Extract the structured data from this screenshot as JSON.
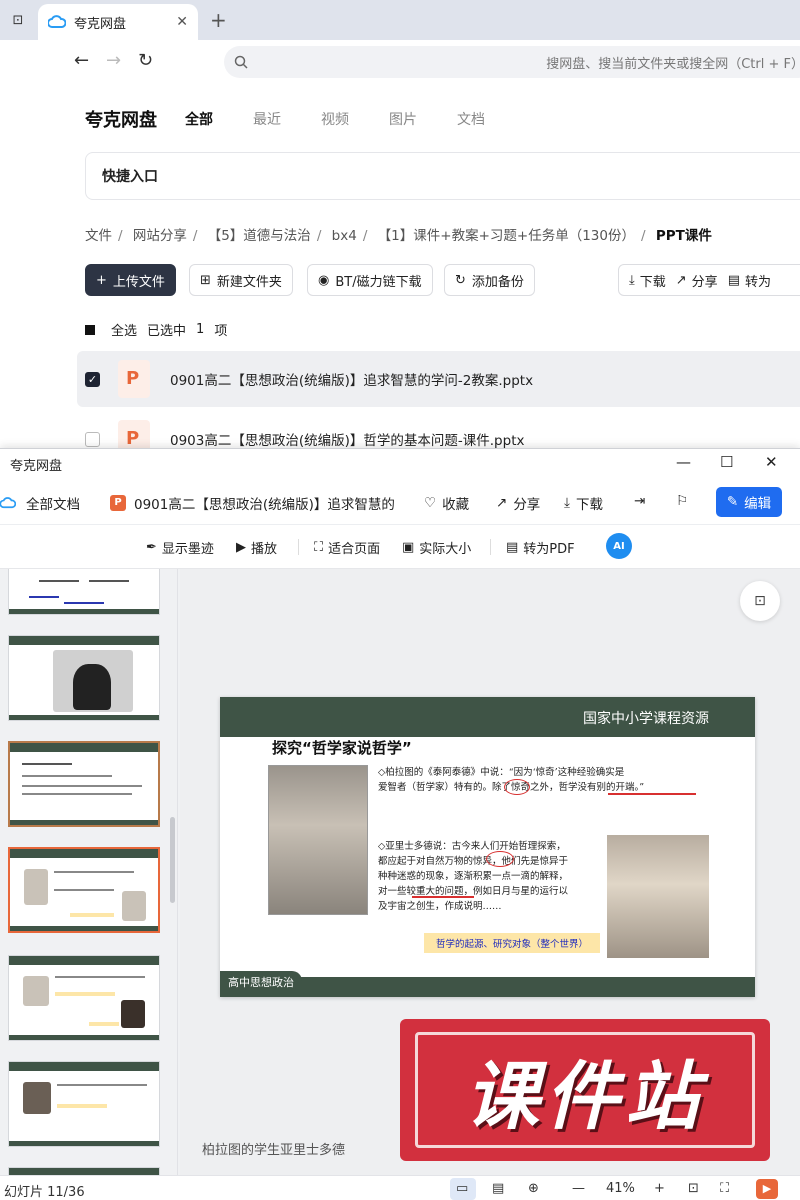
{
  "browser": {
    "tab_title": "夸克网盘",
    "search_placeholder": "搜网盘、搜当前文件夹或搜全网（Ctrl + F）"
  },
  "drive": {
    "brand": "夸克网盘",
    "nav_tabs": [
      "全部",
      "最近",
      "视频",
      "图片",
      "文档"
    ],
    "quick_entry": "快捷入口",
    "breadcrumb": [
      "文件",
      "网站分享",
      "【5】道德与法治",
      "bx4",
      "【1】课件+教案+习题+任务单（130份）",
      "PPT课件"
    ],
    "actions": {
      "upload": "上传文件",
      "new_folder": "新建文件夹",
      "bt": "BT/磁力链下载",
      "backup": "添加备份",
      "download": "下载",
      "share": "分享",
      "convert": "转为"
    },
    "selection": {
      "select_all": "全选",
      "selected": "已选中",
      "count": "1",
      "unit": "项"
    },
    "files": [
      {
        "name": "0901高二【思想政治(统编版)】追求智慧的学问-2教案.pptx",
        "checked": true
      },
      {
        "name": "0903高二【思想政治(统编版)】哲学的基本问题-课件.pptx",
        "checked": false
      }
    ]
  },
  "viewer": {
    "window_title": "夸克网盘",
    "all_docs": "全部文档",
    "doc_title": "0901高二【思想政治(统编版)】追求智慧的",
    "collect": "收藏",
    "share": "分享",
    "download": "下载",
    "edit": "编辑",
    "tools": {
      "ink": "显示墨迹",
      "play": "播放",
      "fit": "适合页面",
      "actual": "实际大小",
      "to_pdf": "转为PDF",
      "ai": "AI"
    },
    "slide": {
      "org": "国家中小学课程资源",
      "title": "探究“哲学家说哲学”",
      "p1_line1": "◇柏拉图的《泰阿泰德》中说：“因为‘惊奇’这种经验确实是",
      "p1_line2": "爱智者（哲学家）特有的。除了惊奇之外，哲学没有别的开端。”",
      "p2_line1": "◇亚里士多德说：古今来人们开始哲理探索，",
      "p2_line2": "都应起于对自然万物的惊异，他们先是惊异于",
      "p2_line3": "种种迷惑的现象，逐渐积累一点一滴的解释，",
      "p2_line4": "对一些较重大的问题，例如日月与星的运行以",
      "p2_line5": "及宇宙之创生，作成说明……",
      "highlight": "哲学的起源、研究对象（整个世界）",
      "footer": "高中思想政治"
    },
    "stamp_text": "课件站",
    "caption": "柏拉图的学生亚里士多德",
    "status": {
      "slide_count": "幻灯片 11/36",
      "zoom": "41%"
    }
  }
}
